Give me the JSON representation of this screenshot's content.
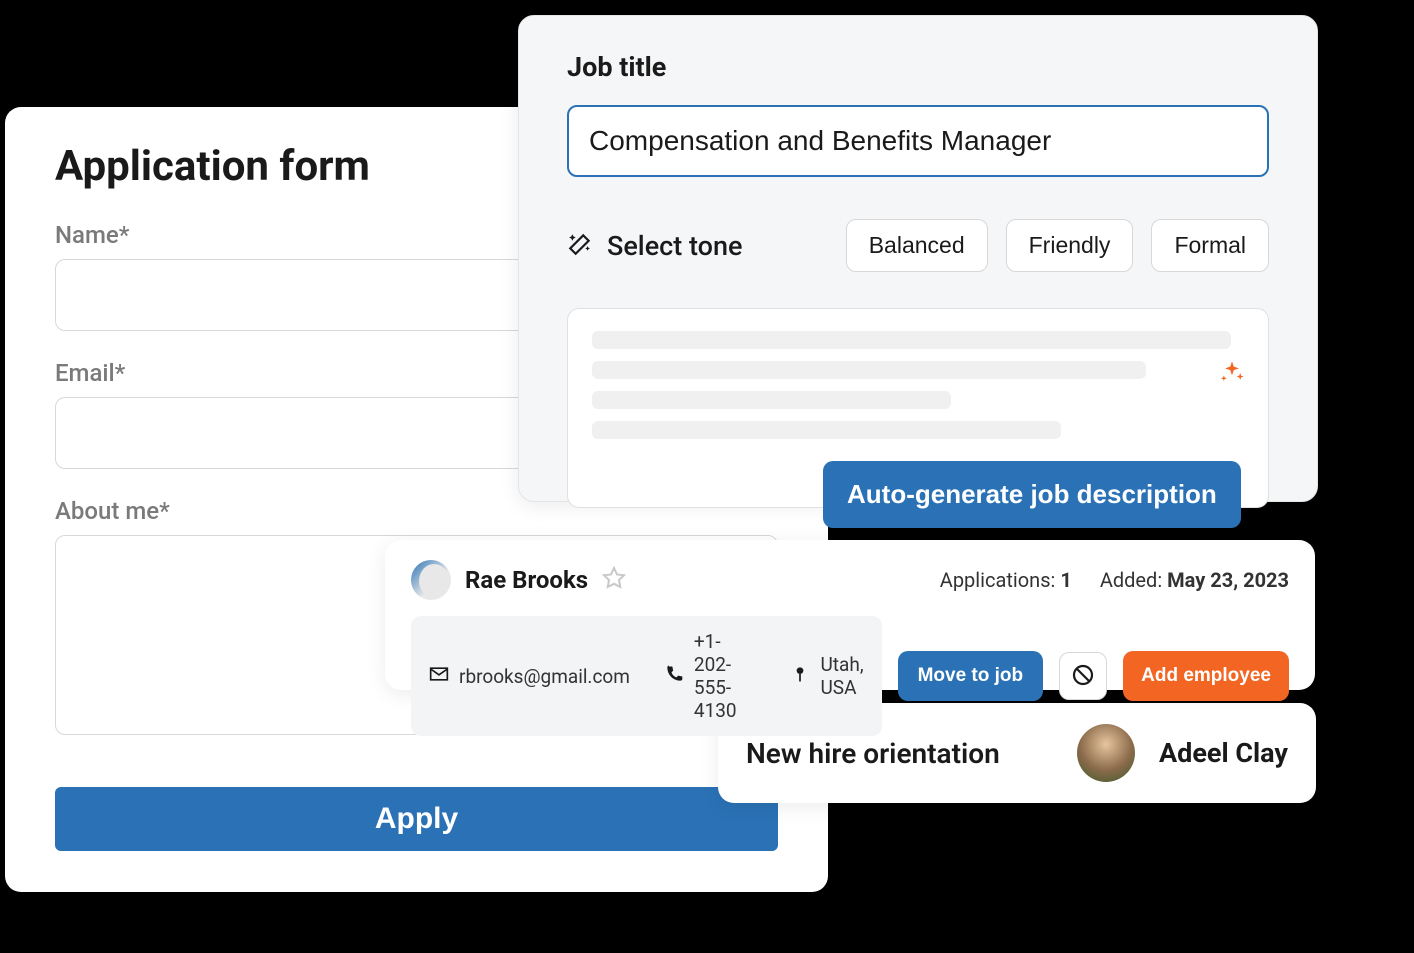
{
  "appForm": {
    "title": "Application form",
    "nameLabel": "Name*",
    "emailLabel": "Email*",
    "aboutLabel": "About me*",
    "applyLabel": "Apply"
  },
  "jobCard": {
    "titleLabel": "Job title",
    "titleValue": "Compensation and Benefits Manager",
    "selectToneLabel": "Select tone",
    "tones": {
      "balanced": "Balanced",
      "friendly": "Friendly",
      "formal": "Formal"
    },
    "autoGenLabel": "Auto-generate job description"
  },
  "candidate": {
    "name": "Rae Brooks",
    "applicationsLabel": "Applications:",
    "applicationsCount": "1",
    "addedLabel": "Added:",
    "addedDate": "May 23, 2023",
    "email": "rbrooks@gmail.com",
    "phone": "+1-202-555-4130",
    "location": "Utah, USA",
    "moveLabel": "Move to job",
    "addEmpLabel": "Add employee"
  },
  "orientation": {
    "title": "New hire orientation",
    "personName": "Adeel Clay"
  }
}
